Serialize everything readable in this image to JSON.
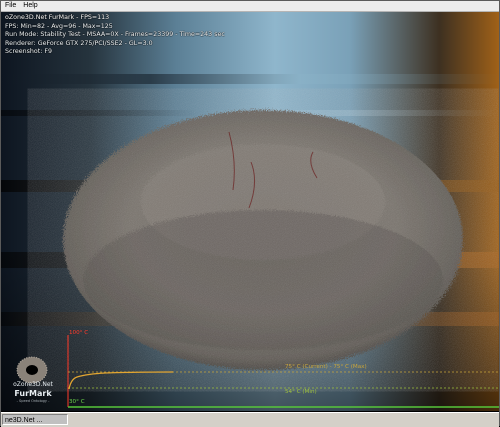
{
  "menu": {
    "items": [
      "File",
      "Help"
    ]
  },
  "hud": {
    "title": "oZone3D.Net FurMark - FPS=113",
    "fps_stats": "FPS: Min=82 - Avg=96 - Max=125",
    "run_mode": "Run Mode: Stability Test - MSAA=0X - Frames=23399 - Time=243 sec",
    "renderer": "Renderer: GeForce GTX 275/PCI/SSE2 - GL=3.0",
    "screenshot_hint": "Screenshot: F9"
  },
  "logo": {
    "line1": "oZone3D.Net",
    "line2": "FurMark",
    "line3": "- Speed Ontology -"
  },
  "temp_graph": {
    "max_label": "100° C",
    "min_label": "30° C",
    "current_max_label": "75° C (Current) - 75° C (Max)",
    "min_reading_label": "54° C (Min)",
    "colors": {
      "axis": "#ff3a2a",
      "curve": "#e2a531",
      "current_line": "#c9a53a",
      "min_line": "#9fc23a",
      "floor": "#56c63a"
    }
  },
  "taskbar": {
    "button_label": "ne3D.Net ..."
  }
}
